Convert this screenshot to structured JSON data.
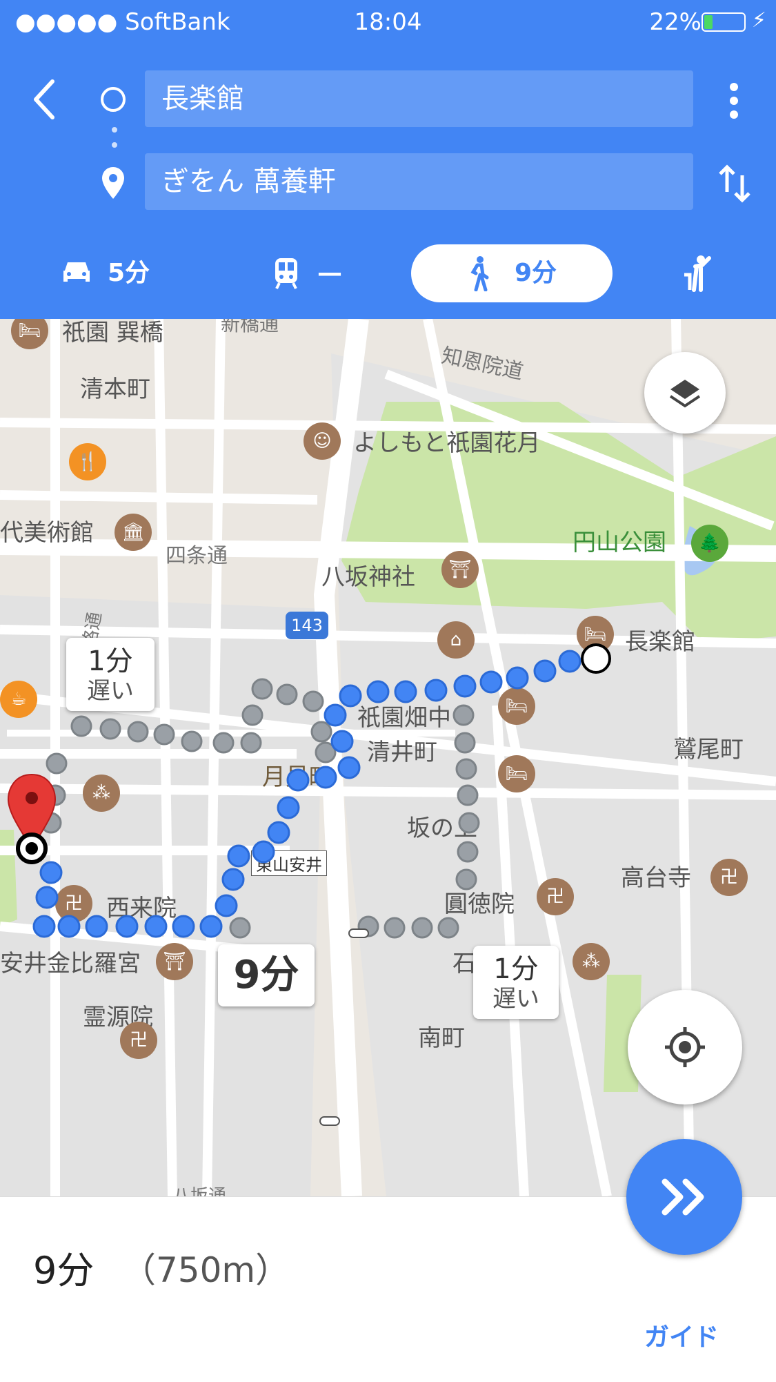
{
  "status": {
    "carrier": "●●●●● SoftBank",
    "time": "18:04",
    "battery": "22%",
    "battery_level": 0.22
  },
  "header": {
    "origin": "長楽館",
    "destination": "ぎをん 萬養軒"
  },
  "modes": [
    {
      "icon": "car-icon",
      "label": "5分"
    },
    {
      "icon": "train-icon",
      "label": "—"
    },
    {
      "icon": "walk-icon",
      "label": "9分",
      "active": true
    },
    {
      "icon": "rideshare-icon",
      "label": ""
    }
  ],
  "map": {
    "labels": {
      "gion_tatsumi": "祇園 巽橋",
      "shinbashi": "新橋通",
      "chionin": "知恩院道",
      "kiyomoto": "清本町",
      "yoshimoto": "よしもと祇園花月",
      "museum": "代美術館",
      "shijo": "四条通",
      "maruyama": "円山公園",
      "yasaka": "八坂神社",
      "chorakukan": "長楽館",
      "route_no": "143",
      "gion_hata": "祇園畑中",
      "kiyoi": "清井町",
      "washio": "鷲尾町",
      "tsukimi": "月見町",
      "sakanoue": "坂の上",
      "kodaiji": "高台寺",
      "higashiyama": "東山安井",
      "sairaiin": "西来院",
      "enokuin": "圓徳院",
      "yasui": "安井金比羅宮",
      "ishibe": "石塀小路",
      "reigen": "霊源院",
      "minami": "南町",
      "hanamikoji": "花見小路通",
      "hachiken": "八坂通"
    },
    "callout_alt1": {
      "time": "1分",
      "note": "遅い"
    },
    "callout_main": {
      "time": "9分"
    },
    "callout_alt2": {
      "time": "1分",
      "note": "遅い"
    }
  },
  "summary": {
    "duration": "9分",
    "distance": "（750m）",
    "guide": "ガイド"
  },
  "colors": {
    "accent": "#4285f4",
    "route": "#4285f4",
    "alt": "#9aa0a6",
    "park": "#cbe5a8",
    "poi": "#a0785a"
  }
}
